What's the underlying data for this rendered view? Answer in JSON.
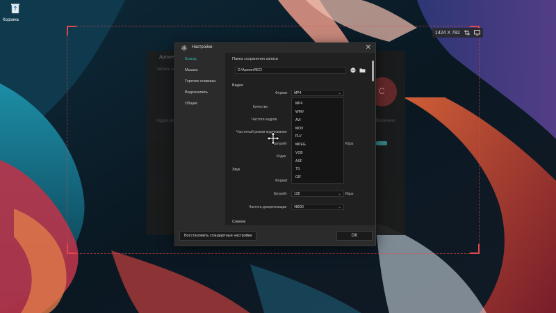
{
  "desktop": {
    "recycle_bin_label": "Корзина"
  },
  "capture": {
    "size_label": "1424 X 782",
    "accent_color": "#e0484c"
  },
  "background_app": {
    "title": "Apowersoft",
    "subtitle": "Запись экрана",
    "rec_symbol": "C",
    "row_left": "Аудио вход",
    "row_right": "Включено"
  },
  "dialog": {
    "title": "Настройки",
    "close_symbol": "✕",
    "sidebar": [
      {
        "label": "Вывод",
        "active": true
      },
      {
        "label": "Мышка",
        "active": false
      },
      {
        "label": "Горячие клавиши",
        "active": false
      },
      {
        "label": "Видеозапись",
        "active": false
      },
      {
        "label": "Общие",
        "active": false
      }
    ],
    "save_folder_label": "Папка сохранения записи",
    "save_folder_path": "D:\\ApowerREC\\",
    "video": {
      "section": "Видео",
      "format_label": "Формат",
      "format_value": "MP4",
      "quality_label": "Качество",
      "fps_label": "Частота кадров",
      "encoding_label": "Частотный режим кодирования",
      "bitrate_label": "Битрейт",
      "bitrate_unit": "Kbps",
      "codec_label": "Кодек"
    },
    "format_options": [
      "MP4",
      "WMV",
      "AVI",
      "MOV",
      "FLV",
      "MPEG",
      "VOB",
      "ASF",
      "TS",
      "GIF"
    ],
    "audio": {
      "section": "Звук",
      "format_label": "Формат",
      "bitrate_label": "Битрейт",
      "bitrate_value": "128",
      "bitrate_unit": "Kbps",
      "sample_rate_label": "Частота дискретизации",
      "sample_rate_value": "48000"
    },
    "screenshot_section": "Снимок",
    "reset_button": "Восстановить стандартные настройки",
    "ok_button": "OK",
    "accent_color": "#2fb1a8"
  }
}
